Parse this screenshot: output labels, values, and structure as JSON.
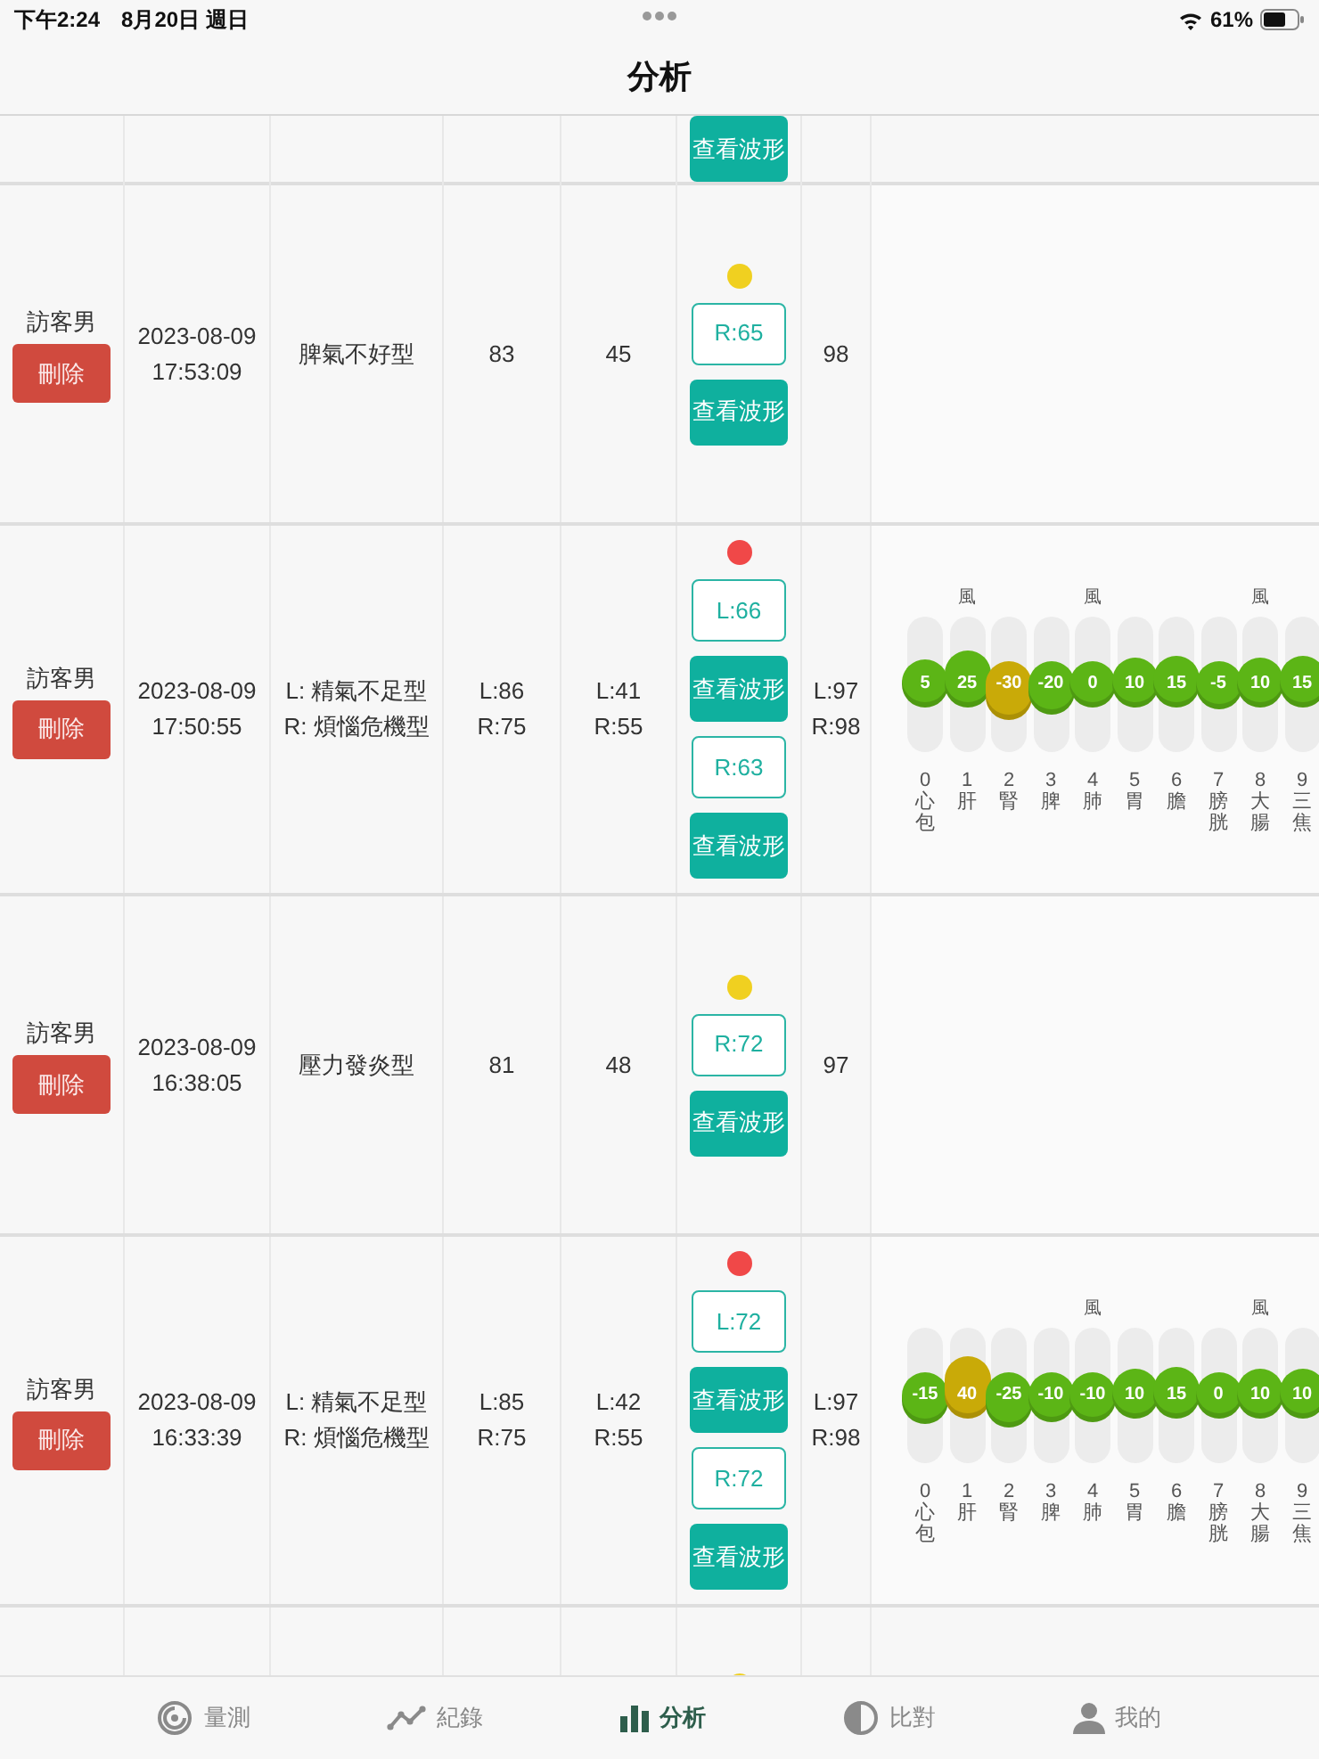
{
  "status_bar": {
    "time": "下午2:24",
    "date": "8月20日 週日",
    "battery": "61%"
  },
  "header": {
    "title": "分析"
  },
  "table": {
    "partial_top_row": {
      "wave_button": "查看波形"
    },
    "rows": [
      {
        "name": "訪客男",
        "delete": "刪除",
        "date": "2023-08-09",
        "time": "17:53:09",
        "pattern": [
          "脾氣不好型"
        ],
        "column_4": [
          "83"
        ],
        "column_5": [
          "45"
        ],
        "dot": {
          "color": "#f0d020"
        },
        "waveforms": [
          {
            "reading": "R:65",
            "button": "查看波形"
          }
        ],
        "column_7": [
          "98"
        ]
      },
      {
        "name": "訪客男",
        "delete": "刪除",
        "date": "2023-08-09",
        "time": "17:50:55",
        "pattern": [
          "L: 精氣不足型",
          "R: 煩惱危機型"
        ],
        "column_4": [
          "L:86",
          "R:75"
        ],
        "column_5": [
          "L:41",
          "R:55"
        ],
        "dot": {
          "color": "#f04848"
        },
        "waveforms": [
          {
            "reading": "L:66",
            "button": "查看波形"
          },
          {
            "reading": "R:63",
            "button": "查看波形"
          }
        ],
        "column_7": [
          "L:97",
          "R:98"
        ],
        "meridians": [
          {
            "index": "0",
            "organ": "心包",
            "value": "5",
            "color": "#5cb516"
          },
          {
            "index": "1",
            "organ": "肝",
            "value": "25",
            "color": "#5cb516",
            "note": "風"
          },
          {
            "index": "2",
            "organ": "腎",
            "value": "-30",
            "color": "#c9aa08"
          },
          {
            "index": "3",
            "organ": "脾",
            "value": "-20",
            "color": "#5cb516"
          },
          {
            "index": "4",
            "organ": "肺",
            "value": "0",
            "color": "#5cb516",
            "note": "風"
          },
          {
            "index": "5",
            "organ": "胃",
            "value": "10",
            "color": "#5cb516"
          },
          {
            "index": "6",
            "organ": "膽",
            "value": "15",
            "color": "#5cb516"
          },
          {
            "index": "7",
            "organ": "膀胱",
            "value": "-5",
            "color": "#5cb516"
          },
          {
            "index": "8",
            "organ": "大腸",
            "value": "10",
            "color": "#5cb516",
            "note": "風"
          },
          {
            "index": "9",
            "organ": "三焦",
            "value": "15",
            "color": "#5cb516"
          }
        ]
      },
      {
        "name": "訪客男",
        "delete": "刪除",
        "date": "2023-08-09",
        "time": "16:38:05",
        "pattern": [
          "壓力發炎型"
        ],
        "column_4": [
          "81"
        ],
        "column_5": [
          "48"
        ],
        "dot": {
          "color": "#f0d020"
        },
        "waveforms": [
          {
            "reading": "R:72",
            "button": "查看波形"
          }
        ],
        "column_7": [
          "97"
        ]
      },
      {
        "name": "訪客男",
        "delete": "刪除",
        "date": "2023-08-09",
        "time": "16:33:39",
        "pattern": [
          "L: 精氣不足型",
          "R: 煩惱危機型"
        ],
        "column_4": [
          "L:85",
          "R:75"
        ],
        "column_5": [
          "L:42",
          "R:55"
        ],
        "dot": {
          "color": "#f04848"
        },
        "waveforms": [
          {
            "reading": "L:72",
            "button": "查看波形"
          },
          {
            "reading": "R:72",
            "button": "查看波形"
          }
        ],
        "column_7": [
          "L:97",
          "R:98"
        ],
        "meridians": [
          {
            "index": "0",
            "organ": "心包",
            "value": "-15",
            "color": "#5cb516"
          },
          {
            "index": "1",
            "organ": "肝",
            "value": "40",
            "color": "#c9aa08"
          },
          {
            "index": "2",
            "organ": "腎",
            "value": "-25",
            "color": "#5cb516"
          },
          {
            "index": "3",
            "organ": "脾",
            "value": "-10",
            "color": "#5cb516"
          },
          {
            "index": "4",
            "organ": "肺",
            "value": "-10",
            "color": "#5cb516",
            "note": "風"
          },
          {
            "index": "5",
            "organ": "胃",
            "value": "10",
            "color": "#5cb516"
          },
          {
            "index": "6",
            "organ": "膽",
            "value": "15",
            "color": "#5cb516"
          },
          {
            "index": "7",
            "organ": "膀胱",
            "value": "0",
            "color": "#5cb516"
          },
          {
            "index": "8",
            "organ": "大腸",
            "value": "10",
            "color": "#5cb516",
            "note": "風"
          },
          {
            "index": "9",
            "organ": "三焦",
            "value": "10",
            "color": "#5cb516"
          }
        ]
      }
    ],
    "partial_bottom_row": {
      "dot": {
        "color": "#f0d020"
      }
    }
  },
  "tab_bar": [
    {
      "kind": "measure",
      "label": "量測",
      "selected": false
    },
    {
      "kind": "records",
      "label": "紀錄",
      "selected": false
    },
    {
      "kind": "analysis",
      "label": "分析",
      "selected": true
    },
    {
      "kind": "compare",
      "label": "比對",
      "selected": false
    },
    {
      "kind": "profile",
      "label": "我的",
      "selected": false
    }
  ]
}
